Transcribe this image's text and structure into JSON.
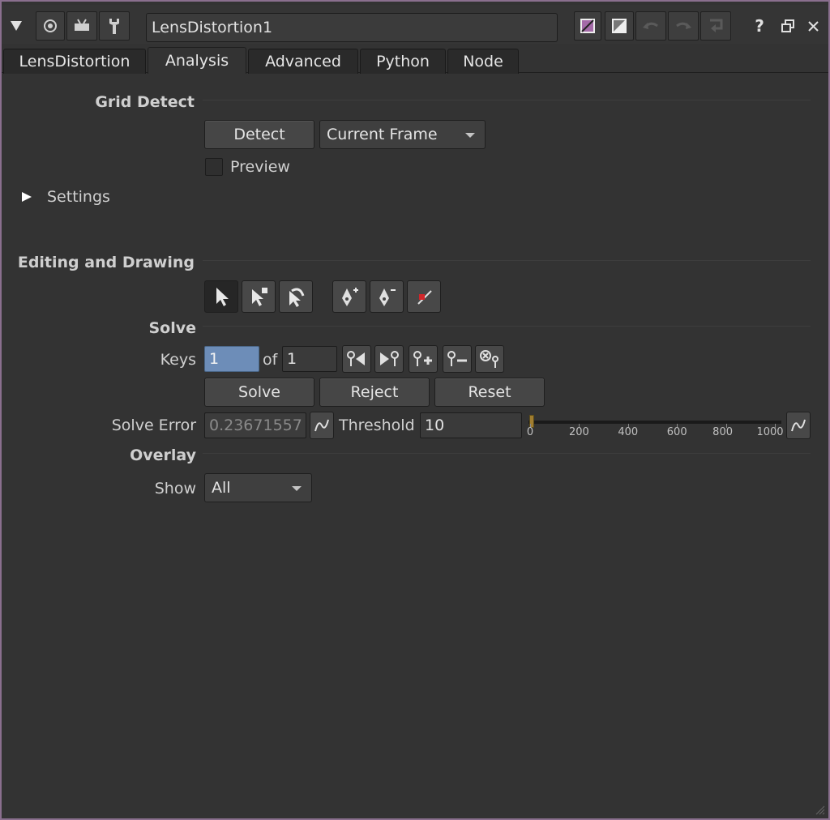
{
  "node": {
    "name": "LensDistortion1"
  },
  "tabs": [
    "LensDistortion",
    "Analysis",
    "Advanced",
    "Python",
    "Node"
  ],
  "active_tab": "Analysis",
  "grid_detect": {
    "title": "Grid Detect",
    "detect_label": "Detect",
    "frame_mode": "Current Frame",
    "preview_label": "Preview",
    "settings_label": "Settings"
  },
  "editing": {
    "title": "Editing and Drawing"
  },
  "solve": {
    "title": "Solve",
    "keys_label": "Keys",
    "key_current": "1",
    "of_label": "of",
    "key_total": "1",
    "solve_label": "Solve",
    "reject_label": "Reject",
    "reset_label": "Reset",
    "error_label": "Solve Error",
    "error_value": "0.23671557",
    "threshold_label": "Threshold",
    "threshold_value": "10",
    "threshold_value_num": 10,
    "threshold_range": [
      0,
      1000
    ],
    "slider_ticks": [
      "0",
      "200",
      "400",
      "600",
      "800",
      "1000"
    ]
  },
  "overlay": {
    "title": "Overlay",
    "show_label": "Show",
    "show_value": "All"
  },
  "colors": {
    "accent_border": "#8a6f8e",
    "key_field": "#6d8db8",
    "slider_handle": "#a07d30"
  }
}
